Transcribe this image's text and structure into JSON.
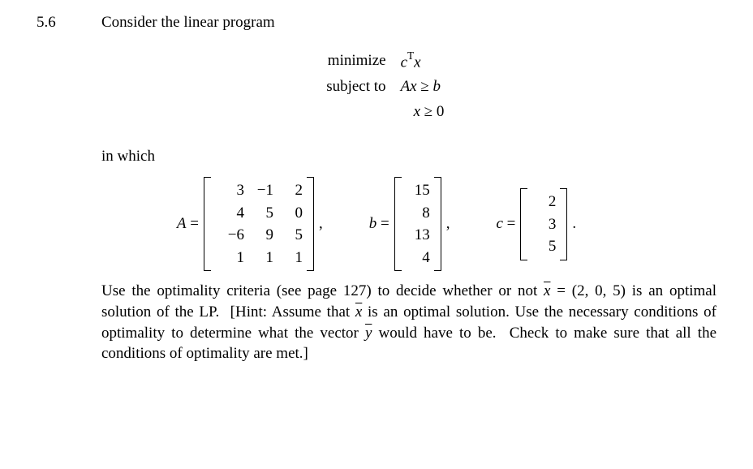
{
  "problem": {
    "number": "5.6",
    "intro": "Consider the linear program",
    "lp": {
      "minimize": "minimize",
      "objective": "cᵀx",
      "subject_to": "subject to",
      "constraint1_lhs": "Ax",
      "constraint1_rel": "≥",
      "constraint1_rhs": "b",
      "constraint2_lhs": "x",
      "constraint2_rel": "≥",
      "constraint2_rhs": "0"
    },
    "in_which": "in which",
    "matrices": {
      "A_label": "A =",
      "A": [
        [
          "3",
          "−1",
          "2"
        ],
        [
          "4",
          "5",
          "0"
        ],
        [
          "−6",
          "9",
          "5"
        ],
        [
          "1",
          "1",
          "1"
        ]
      ],
      "b_label": "b =",
      "b": [
        [
          "15"
        ],
        [
          "8"
        ],
        [
          "13"
        ],
        [
          "4"
        ]
      ],
      "c_label": "c =",
      "c": [
        [
          "2"
        ],
        [
          "3"
        ],
        [
          "5"
        ]
      ]
    },
    "body_text": "Use the optimality criteria (see page 127) to decide whether or not x̄ = (2, 0, 5) is an optimal solution of the LP. [Hint: Assume that x̄ is an optimal solution. Use the necessary conditions of optimality to determine what the vector ȳ would have to be. Check to make sure that all the conditions of optimality are met.]",
    "comma": ",",
    "period": "."
  },
  "chart_data": {
    "type": "table",
    "title": "Linear Program Exercise 5.6",
    "matrix_A": {
      "rows": 4,
      "cols": 3,
      "values": [
        [
          3,
          -1,
          2
        ],
        [
          4,
          5,
          0
        ],
        [
          -6,
          9,
          5
        ],
        [
          1,
          1,
          1
        ]
      ]
    },
    "vector_b": [
      15,
      8,
      13,
      4
    ],
    "vector_c": [
      2,
      3,
      5
    ],
    "candidate_solution": [
      2,
      0,
      5
    ],
    "page_reference": 127
  }
}
